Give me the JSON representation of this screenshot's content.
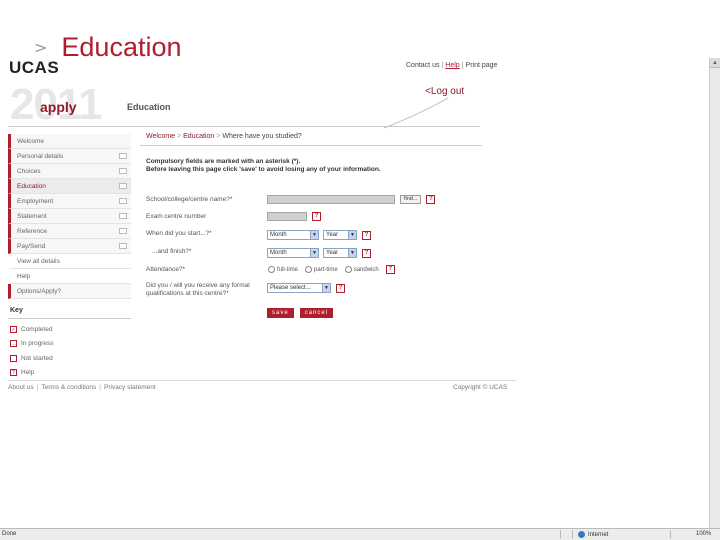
{
  "slide": {
    "chevron": ">",
    "title": "Education"
  },
  "header": {
    "logo": "UCAS",
    "links": [
      "Contact us",
      "Help",
      "Print page"
    ],
    "year": "2011",
    "apply": "apply",
    "section": "Education",
    "logout": "<Log out"
  },
  "sidebar": {
    "items": [
      {
        "label": "Welcome",
        "status": false
      },
      {
        "label": "Personal details",
        "status": true
      },
      {
        "label": "Choices",
        "status": true
      },
      {
        "label": "Education",
        "status": true,
        "active": true
      },
      {
        "label": "Employment",
        "status": true
      },
      {
        "label": "Statement",
        "status": true
      },
      {
        "label": "Reference",
        "status": true
      },
      {
        "label": "Pay/Send",
        "status": true
      },
      {
        "label": "View all details",
        "status": false
      },
      {
        "label": "Help",
        "status": false
      },
      {
        "label": "Options/Apply?",
        "status": false
      }
    ],
    "key": {
      "title": "Key",
      "items": [
        {
          "icon": "✓",
          "label": "Completed"
        },
        {
          "icon": "…",
          "label": "In progress"
        },
        {
          "icon": "",
          "label": "Not started"
        },
        {
          "icon": "?",
          "label": "Help"
        }
      ]
    }
  },
  "main": {
    "breadcrumb": [
      "Welcome",
      "Education",
      "Where have you studied?"
    ],
    "notice_1": "Compulsory fields are marked with an asterisk (*).",
    "notice_2": "Before leaving this page click 'save' to avoid losing any of your information.",
    "fields": {
      "school_label": "School/college/centre name?*",
      "find_label": "find...",
      "exam_label": "Exam centre number",
      "start_label": "When did you start...?*",
      "finish_label": "...and finish?*",
      "month": "Month",
      "year": "Year",
      "attendance_label": "Attendance?*",
      "attendance_options": [
        "full-time",
        "part-time",
        "sandwich"
      ],
      "quals_label_1": "Did you / will you receive any formal",
      "quals_label_2": "qualifications at this centre?*",
      "quals_value": "Please select..."
    },
    "help_glyph": "?",
    "dropdown_glyph": "▼",
    "save": "save",
    "cancel": "cancel"
  },
  "footer": {
    "links": [
      "About us",
      "Terms & conditions",
      "Privacy statement"
    ],
    "copyright": "Copyright © UCAS"
  },
  "statusbar": {
    "left": "Done",
    "zone": "Internet",
    "zoom": "100%"
  },
  "colors": {
    "accent": "#b01e2d",
    "dark_accent": "#8b1a2b"
  }
}
